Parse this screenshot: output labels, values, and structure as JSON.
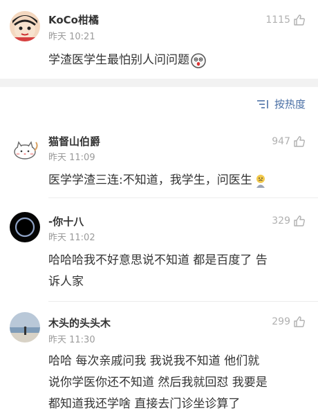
{
  "post": {
    "username": "KoCo柑橘",
    "time": "昨天 10:21",
    "likes": "1115",
    "text": "学渣医学生最怕别人问问题"
  },
  "sort": {
    "label": "按热度"
  },
  "comments": [
    {
      "username": "猫督山伯爵",
      "time": "昨天 11:09",
      "likes": "947",
      "text": "医学学渣三连:不知道，我学生，问医生"
    },
    {
      "username": "-你十八",
      "time": "昨天 11:02",
      "likes": "329",
      "text_lines": [
        "哈哈哈我不好意思说不知道 都是百度了 告",
        "诉人家"
      ]
    },
    {
      "username": "木头的头头木",
      "time": "昨天 11:30",
      "likes": "299",
      "text_lines": [
        "哈哈 每次亲戚问我 我说我不知道 他们就",
        "说你学医你还不知道 然后我就回怼 我要是",
        "都知道我还学啥 直接去门诊坐诊算了"
      ]
    }
  ],
  "colors": {
    "link": "#4a6fa5",
    "meta": "#9a9a9a",
    "text": "#333333",
    "separator": "#f2f2f2"
  },
  "icons": [
    "thumbs-up-icon",
    "sort-lines-icon",
    "surprised-face-emoji-icon",
    "crying-face-emoji-icon"
  ]
}
